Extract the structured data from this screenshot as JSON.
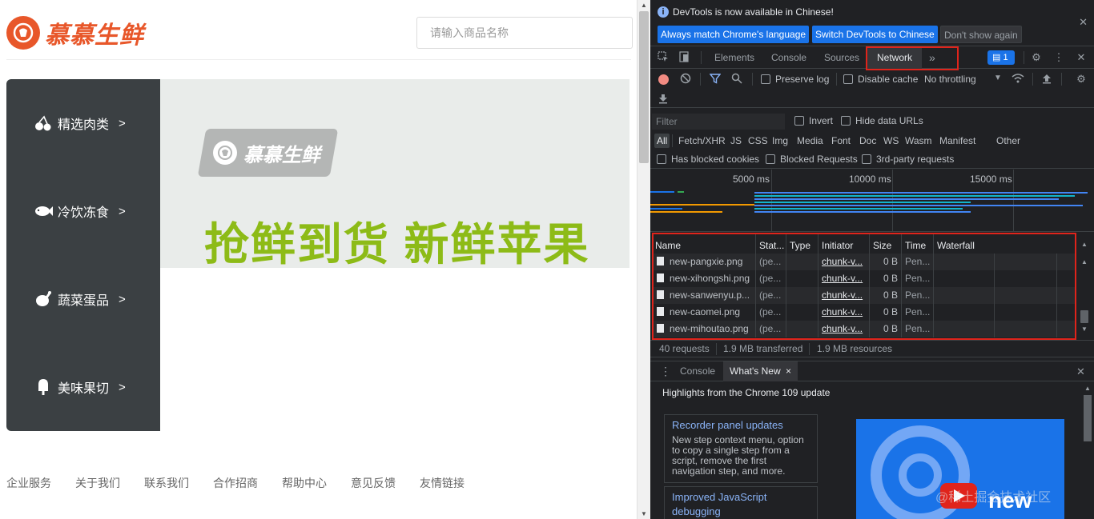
{
  "webpage": {
    "logo_text": "慕慕生鲜",
    "search_placeholder": "请输入商品名称",
    "categories": [
      {
        "label": "精选肉类",
        "icon": "cherry-icon",
        "arrow": ">"
      },
      {
        "label": "冷饮冻食",
        "icon": "fish-icon",
        "arrow": ">"
      },
      {
        "label": "蔬菜蛋品",
        "icon": "chicken-leg-icon",
        "arrow": ">"
      },
      {
        "label": "美味果切",
        "icon": "popsicle-icon",
        "arrow": ">"
      }
    ],
    "banner": {
      "badge_text": "慕慕生鲜",
      "slogan": "抢鲜到货  新鲜苹果"
    },
    "footer_links": [
      "企业服务",
      "关于我们",
      "联系我们",
      "合作招商",
      "帮助中心",
      "意见反馈",
      "友情链接"
    ]
  },
  "devtools": {
    "infobar": {
      "message": "DevTools is now available in Chinese!",
      "btn_match": "Always match Chrome's language",
      "btn_switch": "Switch DevTools to Chinese",
      "btn_dismiss": "Don't show again"
    },
    "tabs": {
      "elements": "Elements",
      "console": "Console",
      "sources": "Sources",
      "network": "Network",
      "more": "»",
      "issues_count": "1"
    },
    "toolbar": {
      "preserve_log": "Preserve log",
      "disable_cache": "Disable cache",
      "throttling": "No throttling"
    },
    "filter": {
      "placeholder": "Filter",
      "invert": "Invert",
      "hide_data_urls": "Hide data URLs"
    },
    "types": [
      "All",
      "Fetch/XHR",
      "JS",
      "CSS",
      "Img",
      "Media",
      "Font",
      "Doc",
      "WS",
      "Wasm",
      "Manifest",
      "Other"
    ],
    "blocking": {
      "blocked_cookies": "Has blocked cookies",
      "blocked_requests": "Blocked Requests",
      "third_party": "3rd-party requests"
    },
    "overview_ticks": [
      "5000 ms",
      "10000 ms",
      "15000 ms"
    ],
    "table": {
      "headers": [
        "Name",
        "Stat...",
        "Type",
        "Initiator",
        "Size",
        "Time",
        "Waterfall"
      ],
      "rows": [
        {
          "name": "new-pangxie.png",
          "status": "(pe...",
          "type": "",
          "initiator": "chunk-v...",
          "size": "0 B",
          "time": "Pen..."
        },
        {
          "name": "new-xihongshi.png",
          "status": "(pe...",
          "type": "",
          "initiator": "chunk-v...",
          "size": "0 B",
          "time": "Pen..."
        },
        {
          "name": "new-sanwenyu.p...",
          "status": "(pe...",
          "type": "",
          "initiator": "chunk-v...",
          "size": "0 B",
          "time": "Pen..."
        },
        {
          "name": "new-caomei.png",
          "status": "(pe...",
          "type": "",
          "initiator": "chunk-v...",
          "size": "0 B",
          "time": "Pen..."
        },
        {
          "name": "new-mihoutao.png",
          "status": "(pe...",
          "type": "",
          "initiator": "chunk-v...",
          "size": "0 B",
          "time": "Pen..."
        }
      ]
    },
    "status": {
      "requests": "40 requests",
      "transferred": "1.9 MB transferred",
      "resources": "1.9 MB resources"
    },
    "drawer": {
      "console_tab": "Console",
      "whats_new_tab": "What's New",
      "close": "×",
      "highlights": "Highlights from the Chrome 109 update",
      "card1_title": "Recorder panel updates",
      "card1_body": "New step context menu, option to copy a single step from a script, remove the first navigation step, and more.",
      "card2_title": "Improved JavaScript debugging",
      "image_text": "new"
    },
    "watermark": "@稀土掘金技术社区"
  }
}
